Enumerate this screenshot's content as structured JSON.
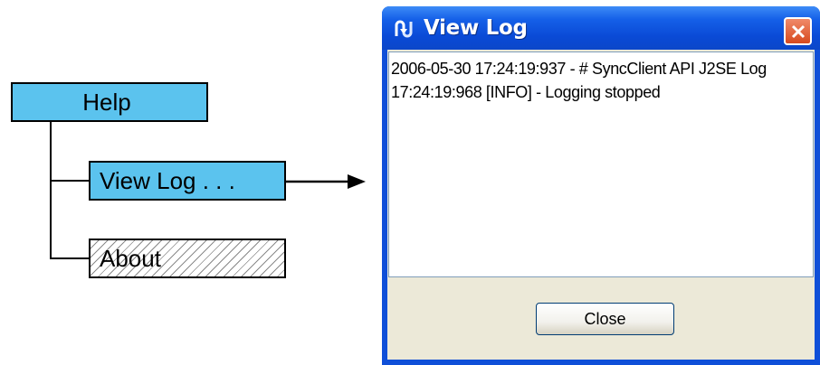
{
  "menu": {
    "parent_label": "Help",
    "items": [
      {
        "label": "View Log . . ."
      },
      {
        "label": "About"
      }
    ]
  },
  "window": {
    "title": "View Log",
    "log_lines": [
      "2006-05-30 17:24:19:937 - # SyncClient API J2SE Log",
      "17:24:19:968 [INFO] - Logging stopped"
    ],
    "close_button_label": "Close",
    "titlebar_color": "#0a4ad6",
    "close_x_color": "#d74a1e"
  },
  "colors": {
    "menu_box": "#5bc3ee"
  },
  "icons": {
    "app": "sync-icon",
    "close": "close-icon",
    "arrow": "arrow-right-icon"
  }
}
